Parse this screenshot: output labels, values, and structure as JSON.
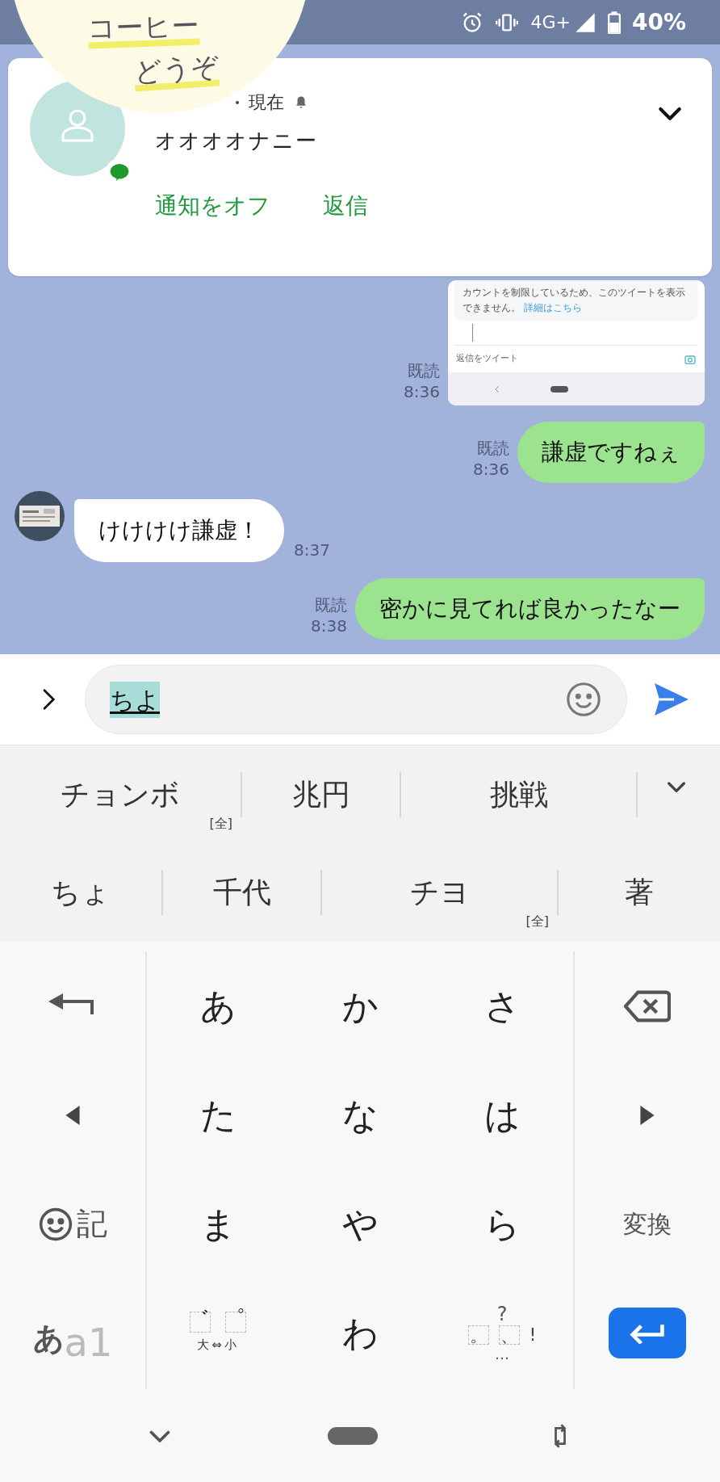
{
  "status_bar": {
    "network": "4G+",
    "battery": "40%"
  },
  "sticker": {
    "lines": [
      "コーヒー",
      "どうぞ"
    ]
  },
  "notification": {
    "time": "現在",
    "message": "オオオオナニー",
    "actions": [
      "通知をオフ",
      "返信"
    ]
  },
  "chat": {
    "messages": [
      {
        "kind": "screenshot",
        "notice": "カウントを制限しているため、このツイートを表示できません。",
        "link": "詳細はこちら",
        "reply_placeholder": "返信をツイート",
        "read": "既読",
        "time": "8:36"
      },
      {
        "kind": "sent",
        "text": "謙虚ですねぇ",
        "read": "既読",
        "time": "8:36"
      },
      {
        "kind": "received",
        "text": "けけけけ謙虚！",
        "time": "8:37"
      },
      {
        "kind": "sent",
        "text": "密かに見てれば良かったなー",
        "read": "既読",
        "time": "8:38"
      }
    ]
  },
  "input": {
    "value": "ちよ"
  },
  "candidates": [
    [
      {
        "text": "チョンボ",
        "tag": "[全]"
      },
      {
        "text": "兆円"
      },
      {
        "text": "挑戦"
      }
    ],
    [
      {
        "text": "ちょ"
      },
      {
        "text": "千代"
      },
      {
        "text": "チヨ",
        "tag": "[全]"
      },
      {
        "text": "著"
      }
    ]
  ],
  "keyboard": {
    "rows": [
      [
        {
          "kind": "undo"
        },
        {
          "kind": "kana",
          "label": "あ"
        },
        {
          "kind": "kana",
          "label": "か"
        },
        {
          "kind": "kana",
          "label": "さ"
        },
        {
          "kind": "backspace"
        }
      ],
      [
        {
          "kind": "left"
        },
        {
          "kind": "kana",
          "label": "た"
        },
        {
          "kind": "kana",
          "label": "な"
        },
        {
          "kind": "kana",
          "label": "は"
        },
        {
          "kind": "right"
        }
      ],
      [
        {
          "kind": "emoji",
          "label": "記"
        },
        {
          "kind": "kana",
          "label": "ま"
        },
        {
          "kind": "kana",
          "label": "や"
        },
        {
          "kind": "kana",
          "label": "ら"
        },
        {
          "kind": "action",
          "label": "変換"
        }
      ],
      [
        {
          "kind": "mode",
          "primary": "あ",
          "secondary": "a1"
        },
        {
          "kind": "dakuten",
          "marks": [
            "゛",
            "゜"
          ],
          "label": "大⇔小"
        },
        {
          "kind": "kana",
          "label": "わ"
        },
        {
          "kind": "punct",
          "top": "?",
          "marks": [
            "。",
            "、",
            "!"
          ],
          "bottom": "…"
        },
        {
          "kind": "enter"
        }
      ]
    ]
  }
}
